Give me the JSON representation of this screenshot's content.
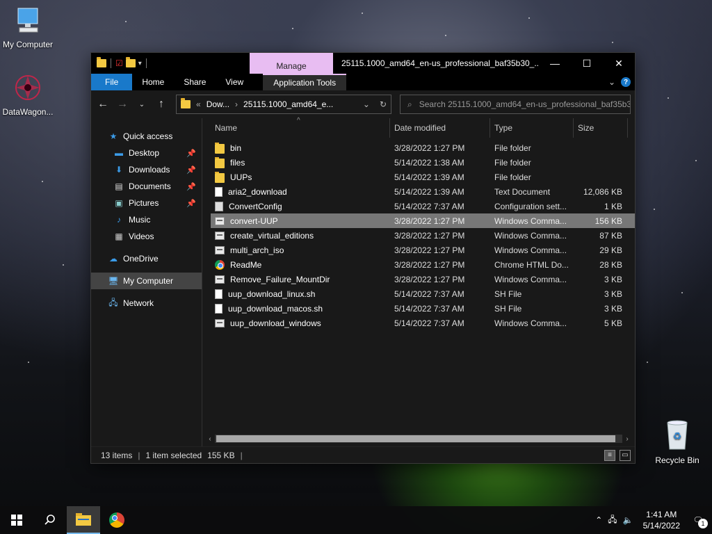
{
  "desktop": {
    "icons": [
      {
        "label": "My Computer",
        "icon": "computer-icon"
      },
      {
        "label": "DataWagon...",
        "icon": "datawagon-icon"
      },
      {
        "label": "Recycle Bin",
        "icon": "recycle-bin-icon"
      }
    ]
  },
  "window": {
    "title": "25115.1000_amd64_en-us_professional_baf35b30_...",
    "manage_tab": "Manage",
    "controls": {
      "minimize": "—",
      "maximize": "☐",
      "close": "✕"
    },
    "ribbon_tabs": [
      "File",
      "Home",
      "Share",
      "View"
    ],
    "context_tab": "Application Tools",
    "help_label": "?",
    "address": {
      "prefix": "«",
      "crumb1": "Dow...",
      "crumb2": "25115.1000_amd64_e...",
      "separator": "›"
    },
    "search": {
      "placeholder": "Search 25115.1000_amd64_en-us_professional_baf35b3..."
    },
    "nav_pane": {
      "quick_access": "Quick access",
      "items": [
        {
          "label": "Desktop",
          "icon": "desktop-icon",
          "pinned": true
        },
        {
          "label": "Downloads",
          "icon": "downloads-icon",
          "pinned": true
        },
        {
          "label": "Documents",
          "icon": "documents-icon",
          "pinned": true
        },
        {
          "label": "Pictures",
          "icon": "pictures-icon",
          "pinned": true
        },
        {
          "label": "Music",
          "icon": "music-icon",
          "pinned": false
        },
        {
          "label": "Videos",
          "icon": "videos-icon",
          "pinned": false
        }
      ],
      "onedrive": "OneDrive",
      "my_computer": "My Computer",
      "network": "Network"
    },
    "columns": {
      "name": "Name",
      "date": "Date modified",
      "type": "Type",
      "size": "Size"
    },
    "files": [
      {
        "name": "bin",
        "date": "3/28/2022 1:27 PM",
        "type": "File folder",
        "size": "",
        "kind": "folder"
      },
      {
        "name": "files",
        "date": "5/14/2022 1:38 AM",
        "type": "File folder",
        "size": "",
        "kind": "folder"
      },
      {
        "name": "UUPs",
        "date": "5/14/2022 1:39 AM",
        "type": "File folder",
        "size": "",
        "kind": "folder"
      },
      {
        "name": "aria2_download",
        "date": "5/14/2022 1:39 AM",
        "type": "Text Document",
        "size": "12,086 KB",
        "kind": "txt"
      },
      {
        "name": "ConvertConfig",
        "date": "5/14/2022 7:37 AM",
        "type": "Configuration sett...",
        "size": "1 KB",
        "kind": "conf"
      },
      {
        "name": "convert-UUP",
        "date": "3/28/2022 1:27 PM",
        "type": "Windows Comma...",
        "size": "156 KB",
        "kind": "cmd",
        "selected": true
      },
      {
        "name": "create_virtual_editions",
        "date": "3/28/2022 1:27 PM",
        "type": "Windows Comma...",
        "size": "87 KB",
        "kind": "cmd"
      },
      {
        "name": "multi_arch_iso",
        "date": "3/28/2022 1:27 PM",
        "type": "Windows Comma...",
        "size": "29 KB",
        "kind": "cmd"
      },
      {
        "name": "ReadMe",
        "date": "3/28/2022 1:27 PM",
        "type": "Chrome HTML Do...",
        "size": "28 KB",
        "kind": "chrome"
      },
      {
        "name": "Remove_Failure_MountDir",
        "date": "3/28/2022 1:27 PM",
        "type": "Windows Comma...",
        "size": "3 KB",
        "kind": "cmd"
      },
      {
        "name": "uup_download_linux.sh",
        "date": "5/14/2022 7:37 AM",
        "type": "SH File",
        "size": "3 KB",
        "kind": "sh"
      },
      {
        "name": "uup_download_macos.sh",
        "date": "5/14/2022 7:37 AM",
        "type": "SH File",
        "size": "3 KB",
        "kind": "sh"
      },
      {
        "name": "uup_download_windows",
        "date": "5/14/2022 7:37 AM",
        "type": "Windows Comma...",
        "size": "5 KB",
        "kind": "cmd"
      }
    ],
    "status": {
      "count": "13 items",
      "selected": "1 item selected",
      "size": "155 KB"
    }
  },
  "taskbar": {
    "time": "1:41 AM",
    "date": "5/14/2022",
    "notification_count": "1"
  },
  "colors": {
    "accent": "#1979ca",
    "manage": "#e8bdf2",
    "selection": "#777777"
  }
}
